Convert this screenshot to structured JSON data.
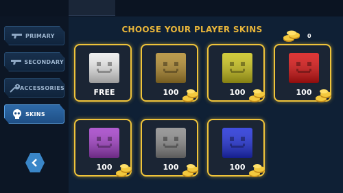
{
  "title": "CHOOSE YOUR PLAYER SKINS",
  "coin_count": "0",
  "colors": {
    "accent": "#f0c43a",
    "title": "#e8b53a",
    "active_tab": "#2e6aa8"
  },
  "sidebar": {
    "items": [
      {
        "label": "PRIMARY",
        "icon": "pistol-icon",
        "active": false
      },
      {
        "label": "SECONDARY",
        "icon": "pistol-icon",
        "active": false
      },
      {
        "label": "ACCESSORIES",
        "icon": "wrench-icon",
        "active": false
      },
      {
        "label": "SKINS",
        "icon": "skull-icon",
        "active": true
      }
    ],
    "back_icon": "chevron-left-icon"
  },
  "skins": [
    {
      "price": "FREE",
      "color": "#ededed"
    },
    {
      "price": "100",
      "color": "#b08a2e"
    },
    {
      "price": "100",
      "color": "#c9c21a"
    },
    {
      "price": "100",
      "color": "#d81212"
    },
    {
      "price": "100",
      "color": "#a33fc8"
    },
    {
      "price": "100",
      "color": "#8a8a8a"
    },
    {
      "price": "100",
      "color": "#1f2fd8"
    }
  ]
}
